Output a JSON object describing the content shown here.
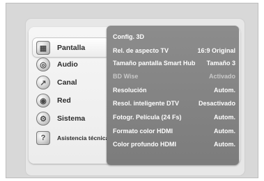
{
  "sidebar": {
    "items": [
      {
        "label": "Pantalla",
        "icon": "monitor-icon"
      },
      {
        "label": "Audio",
        "icon": "audio-icon"
      },
      {
        "label": "Canal",
        "icon": "antenna-icon"
      },
      {
        "label": "Red",
        "icon": "network-icon"
      },
      {
        "label": "Sistema",
        "icon": "system-gear-icon"
      },
      {
        "label": "Asistencia técnica",
        "icon": "help-icon"
      }
    ]
  },
  "settings": {
    "rows": [
      {
        "label": "Config. 3D",
        "value": ""
      },
      {
        "label": "Rel. de aspecto TV",
        "value": "16:9 Original"
      },
      {
        "label": "Tamaño pantalla Smart Hub",
        "value": "Tamaño 3"
      },
      {
        "label": "BD Wise",
        "value": "Activado"
      },
      {
        "label": "Resolución",
        "value": "Autom."
      },
      {
        "label": "Resol. inteligente DTV",
        "value": "Desactivado"
      },
      {
        "label": "Fotogr. Película (24 Fs)",
        "value": "Autom."
      },
      {
        "label": "Formato color HDMI",
        "value": "Autom."
      },
      {
        "label": "Color profundo HDMI",
        "value": "Autom."
      }
    ]
  }
}
